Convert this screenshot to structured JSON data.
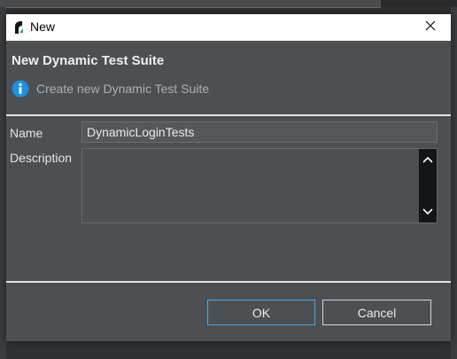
{
  "window": {
    "title": "New",
    "close_icon": "close-icon"
  },
  "header": {
    "title": "New Dynamic Test Suite",
    "message": "Create new Dynamic Test Suite",
    "message_icon": "info-icon"
  },
  "form": {
    "name_label": "Name",
    "name_value": "DynamicLoginTests",
    "description_label": "Description",
    "description_value": ""
  },
  "buttons": {
    "ok_label": "OK",
    "cancel_label": "Cancel"
  },
  "colors": {
    "dialog_background": "#4d5053",
    "accent_focus": "#4aa7e0",
    "info_icon": "#1e90e0"
  }
}
